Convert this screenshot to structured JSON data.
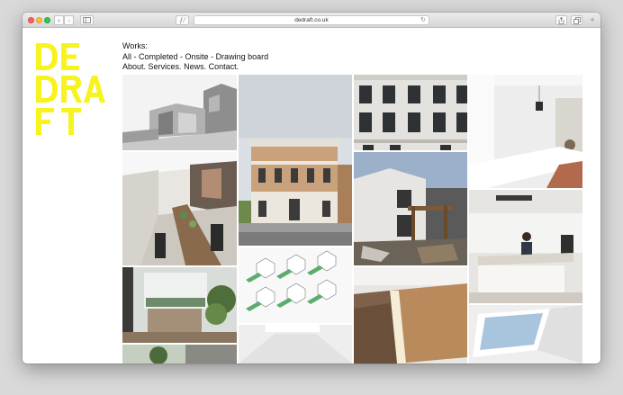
{
  "browser": {
    "url": "dedraft.co.uk",
    "reader_glyph": "ƒ/"
  },
  "site": {
    "logo_text": "DEDRAFT",
    "logo_color": "#f7f31f",
    "heading": "Works:",
    "filters": [
      "All",
      "Completed",
      "Onsite",
      "Drawing board"
    ],
    "filter_separator": " - ",
    "links": [
      "About.",
      "Services.",
      "News.",
      "Contact."
    ]
  },
  "gallery": [
    {
      "id": "render-extension",
      "desc": "3D render of rear extension"
    },
    {
      "id": "kitchen-dining",
      "desc": "Kitchen with long dining table"
    },
    {
      "id": "open-living",
      "desc": "Open plan living space with plants"
    },
    {
      "id": "facade-classical",
      "desc": "Classical brick facade building"
    },
    {
      "id": "axonometric-diagrams",
      "desc": "Axonometric house diagrams"
    },
    {
      "id": "terrace-facade",
      "desc": "Georgian terrace facade"
    },
    {
      "id": "construction-site",
      "desc": "Building under construction"
    },
    {
      "id": "timber-stair",
      "desc": "Timber clad stair"
    },
    {
      "id": "white-kitchen",
      "desc": "White kitchen interior"
    },
    {
      "id": "kitchen-island",
      "desc": "Kitchen island with person"
    },
    {
      "id": "skylight",
      "desc": "Skylight view"
    }
  ]
}
